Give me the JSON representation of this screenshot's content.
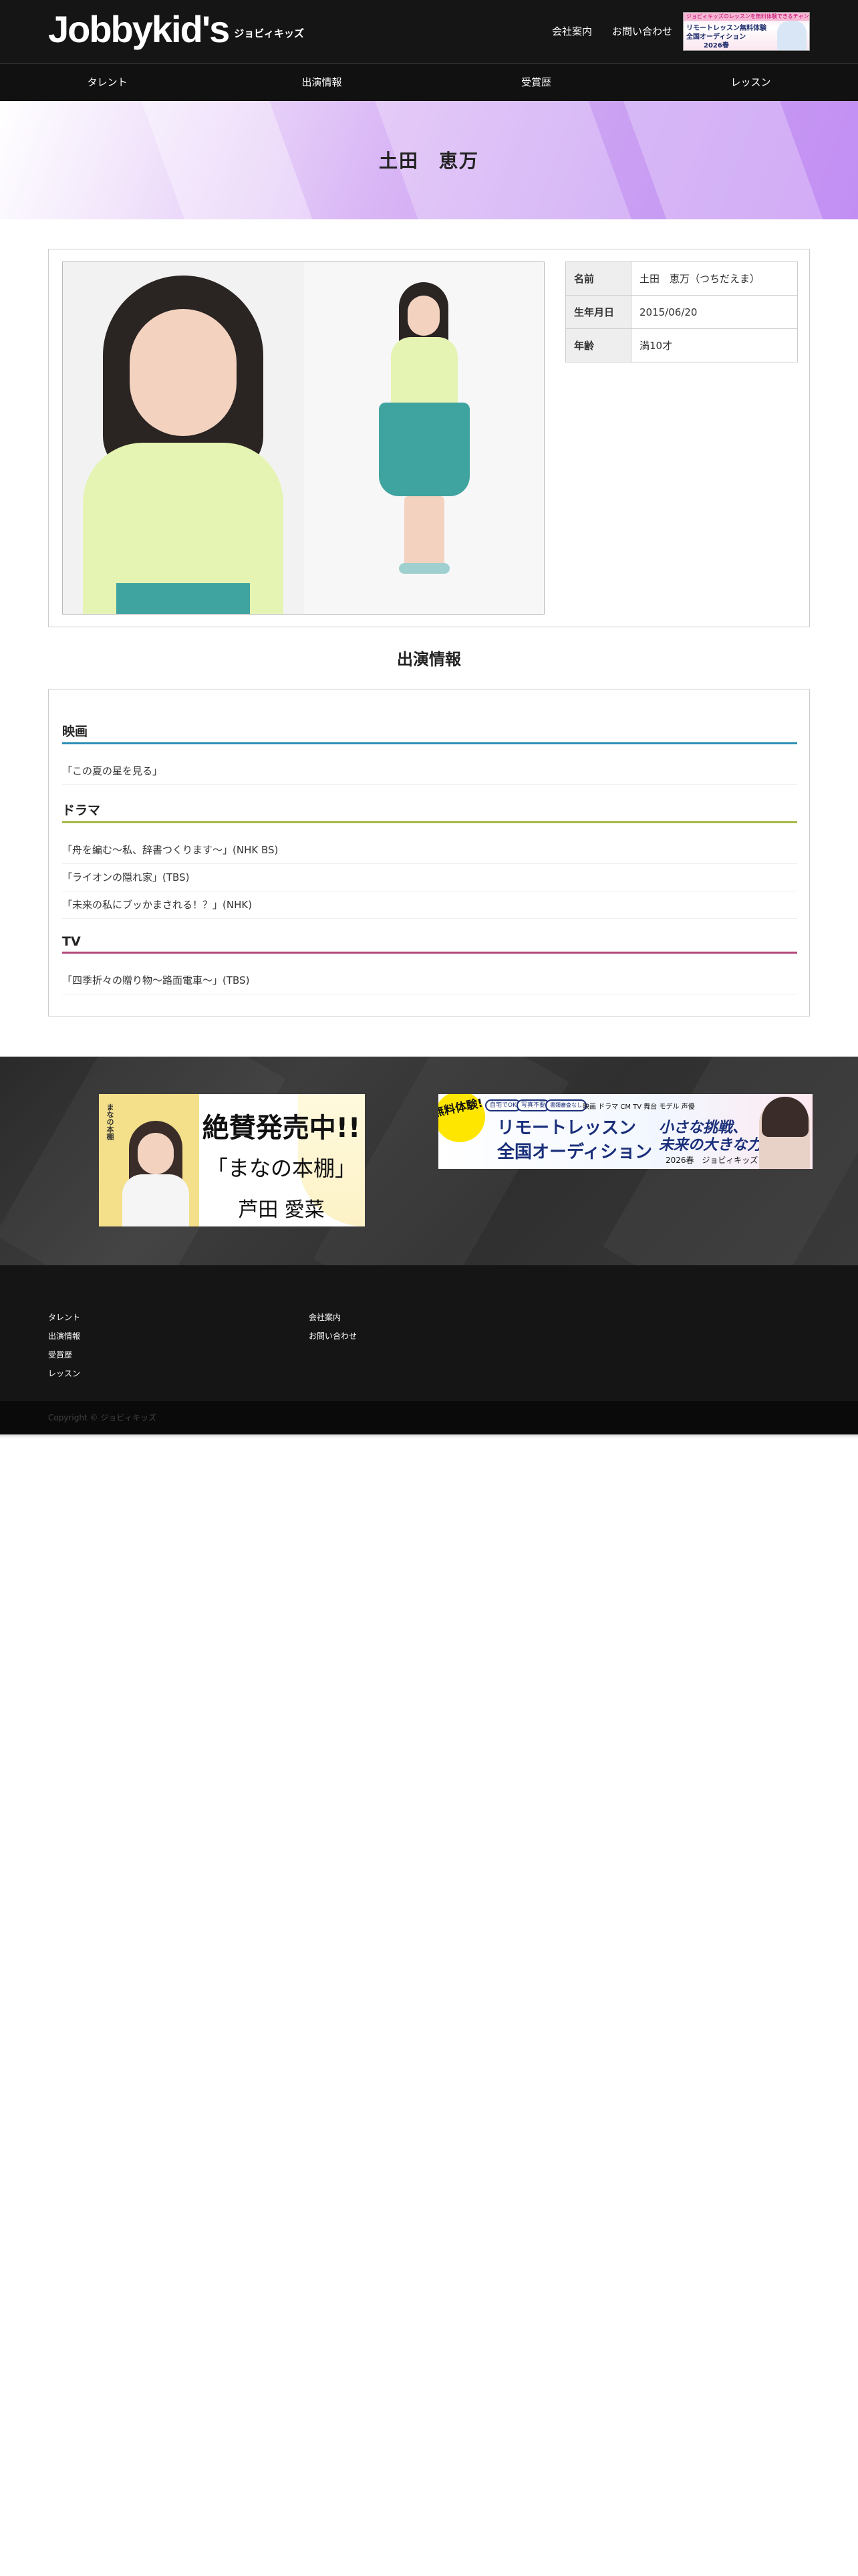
{
  "header": {
    "logo_main": "Jobbykid's",
    "logo_sub": "ジョビィキッズ",
    "links": [
      "会社案内",
      "お問い合わせ"
    ],
    "banner": {
      "strip": "ジョビィキッズのレッスンを無料体験できるチャンス！",
      "line1": "リモートレッスン無料体験",
      "line2": "全国オーディション",
      "line3": "2026春"
    }
  },
  "nav": [
    "タレント",
    "出演情報",
    "受賞歴",
    "レッスン"
  ],
  "hero": {
    "title": "土田　恵万"
  },
  "profile": {
    "rows": [
      {
        "key": "名前",
        "value": "土田　恵万（つちだえま）"
      },
      {
        "key": "生年月日",
        "value": "2015/06/20"
      },
      {
        "key": "年齢",
        "value": "満10才"
      }
    ]
  },
  "appearances": {
    "title": "出演情報",
    "categories": [
      {
        "name": "映画",
        "color": "#2c8fb3",
        "items": [
          "「この夏の星を見る」"
        ]
      },
      {
        "name": "ドラマ",
        "color": "#a7b84a",
        "items": [
          "「舟を編む〜私、辞書つくります〜」(NHK BS)",
          "「ライオンの隠れ家」(TBS)",
          "「未来の私にブッかまされる！？」(NHK)"
        ]
      },
      {
        "name": "TV",
        "color": "#b3457a",
        "items": [
          "「四季折々の贈り物〜路面電車〜」(TBS)"
        ]
      }
    ]
  },
  "banners": {
    "book": {
      "cover_title": "まなの本棚",
      "headline": "絶賛発売中!!",
      "title": "「まなの本棚」",
      "author": "芦田 愛菜"
    },
    "remote": {
      "badge": "無料体験!",
      "pills": [
        "自宅でOK",
        "写真不要",
        "書類審査なし"
      ],
      "genres": "映画 ドラマ CM TV 舞台 モデル 声優",
      "main1": "リモートレッスン",
      "main2": "全国オーディション",
      "side1": "小さな挑戦、",
      "side2": "未来の大きな力",
      "season": "2026春　ジョビィキッズ"
    }
  },
  "footer": {
    "col1": [
      "タレント",
      "出演情報",
      "受賞歴",
      "レッスン"
    ],
    "col2": [
      "会社案内",
      "お問い合わせ"
    ],
    "copyright": "Copyright © ジョビィキッズ"
  }
}
